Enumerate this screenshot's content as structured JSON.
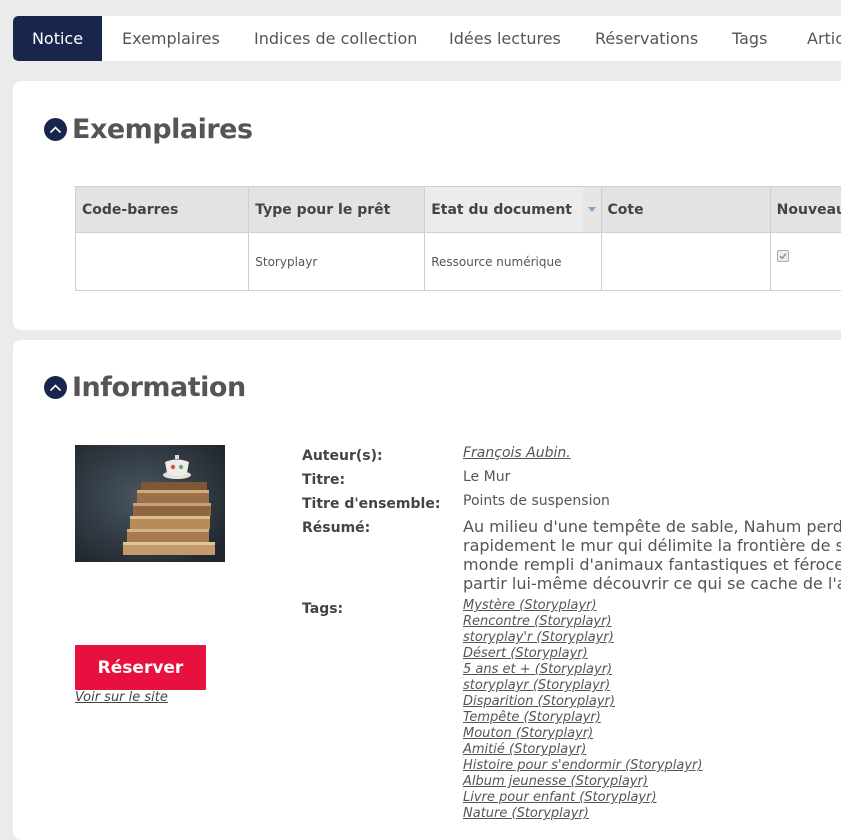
{
  "tabs": [
    "Notice",
    "Exemplaires",
    "Indices de collection",
    "Idées lectures",
    "Réservations",
    "Tags",
    "Articles"
  ],
  "exemplaires": {
    "title": "Exemplaires",
    "columns": [
      "Code-barres",
      "Type pour le prêt",
      "Etat du document",
      "Cote",
      "Nouveau"
    ],
    "rows": [
      {
        "code_barres": "",
        "type_pret": "Storyplayr",
        "etat": "Ressource numérique",
        "cote": "",
        "nouveau": true
      }
    ]
  },
  "information": {
    "title": "Information",
    "reserve_label": "Réserver",
    "voir_label": "Voir sur le site",
    "fields": {
      "auteur_label": "Auteur(s):",
      "auteur_value": "François Aubin.",
      "titre_label": "Titre:",
      "titre_value": "Le Mur",
      "ensemble_label": "Titre d'ensemble:",
      "ensemble_value": "Points de suspension",
      "resume_label": "Résumé:",
      "resume_lines": [
        "Au milieu d'une tempête de sable, Nahum perd le",
        "rapidement le mur qui délimite la frontière de son",
        "monde rempli d'animaux fantastiques et féroces a",
        "partir lui-même découvrir ce qui se cache de l'autr"
      ],
      "tags_label": "Tags:"
    },
    "tags": [
      "Mystère (Storyplayr)",
      "Rencontre (Storyplayr)",
      "storyplay'r (Storyplayr)",
      "Désert (Storyplayr)",
      "5 ans et + (Storyplayr)",
      "storyplayr (Storyplayr)",
      "Disparition (Storyplayr)",
      "Tempête (Storyplayr)",
      "Mouton (Storyplayr)",
      "Amitié (Storyplayr)",
      "Histoire pour s'endormir (Storyplayr)",
      "Album jeunesse (Storyplayr)",
      "Livre pour enfant (Storyplayr)",
      "Nature (Storyplayr)"
    ]
  },
  "colors": {
    "accent": "#17264a",
    "reserve": "#e8103f",
    "background": "#ebebeb"
  }
}
